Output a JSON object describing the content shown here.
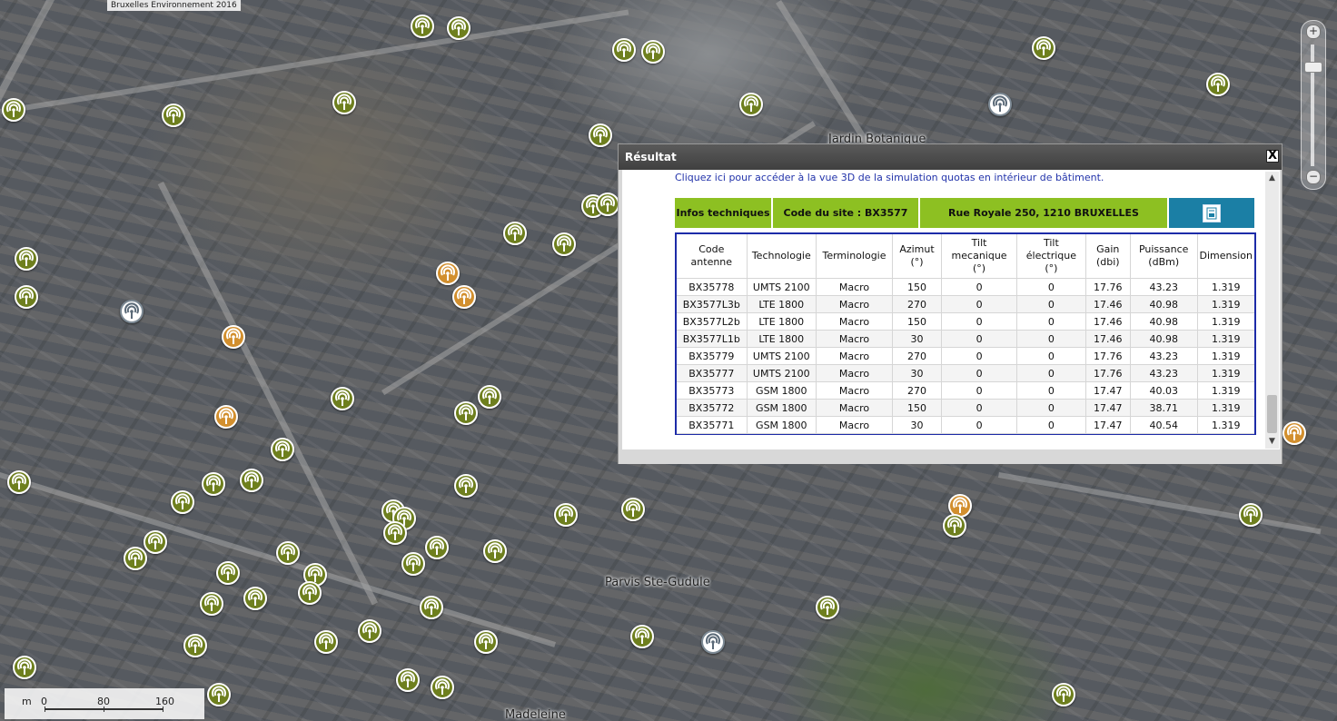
{
  "map": {
    "copyright": "Bruxelles Environnement 2016",
    "labels": [
      "Jardin Botanique",
      "Parvis Ste-Gudule",
      "Madeleine"
    ],
    "scale": {
      "unit": "m",
      "ticks": [
        "0",
        "80",
        "160"
      ]
    },
    "zoom": {
      "plus": "+",
      "minus": "−"
    },
    "marker_colors": {
      "active": "#6e7f1e",
      "planned": "#d28f2e",
      "other": "#ffffff"
    }
  },
  "popup": {
    "title": "Résultat",
    "close": "X",
    "link_3d": "Cliquez ici pour accéder à la vue 3D de la simulation quotas en intérieur de bâtiment.",
    "header": {
      "infos": "Infos techniques",
      "site_code": "Code du site : BX3577",
      "address": "Rue Royale 250, 1210 BRUXELLES"
    },
    "columns": [
      "Code antenne",
      "Technologie",
      "Terminologie",
      "Azimut (°)",
      "Tilt mecanique (°)",
      "Tilt électrique (°)",
      "Gain (dbi)",
      "Puissance (dBm)",
      "Dimension"
    ],
    "rows": [
      [
        "BX35778",
        "UMTS 2100",
        "Macro",
        "150",
        "0",
        "0",
        "17.76",
        "43.23",
        "1.319"
      ],
      [
        "BX3577L3b",
        "LTE 1800",
        "Macro",
        "270",
        "0",
        "0",
        "17.46",
        "40.98",
        "1.319"
      ],
      [
        "BX3577L2b",
        "LTE 1800",
        "Macro",
        "150",
        "0",
        "0",
        "17.46",
        "40.98",
        "1.319"
      ],
      [
        "BX3577L1b",
        "LTE 1800",
        "Macro",
        "30",
        "0",
        "0",
        "17.46",
        "40.98",
        "1.319"
      ],
      [
        "BX35779",
        "UMTS 2100",
        "Macro",
        "270",
        "0",
        "0",
        "17.76",
        "43.23",
        "1.319"
      ],
      [
        "BX35777",
        "UMTS 2100",
        "Macro",
        "30",
        "0",
        "0",
        "17.76",
        "43.23",
        "1.319"
      ],
      [
        "BX35773",
        "GSM 1800",
        "Macro",
        "270",
        "0",
        "0",
        "17.47",
        "40.03",
        "1.319"
      ],
      [
        "BX35772",
        "GSM 1800",
        "Macro",
        "150",
        "0",
        "0",
        "17.47",
        "38.71",
        "1.319"
      ],
      [
        "BX35771",
        "GSM 1800",
        "Macro",
        "30",
        "0",
        "0",
        "17.47",
        "40.54",
        "1.319"
      ]
    ]
  }
}
